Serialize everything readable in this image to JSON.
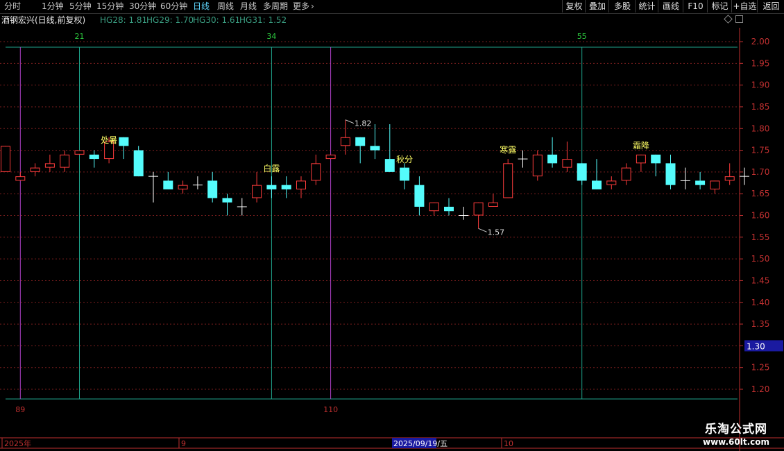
{
  "toolbar": {
    "periods": [
      "分时",
      "1分钟",
      "5分钟",
      "15分钟",
      "30分钟",
      "60分钟",
      "日线",
      "周线",
      "月线",
      "多周期",
      "更多"
    ],
    "more_arrow": "›",
    "active_period": "日线",
    "tools": [
      "复权",
      "叠加",
      "多股",
      "统计",
      "画线",
      "F10",
      "标记",
      "+自选",
      "返回"
    ]
  },
  "stock": {
    "title": "酒钢宏兴(日线,前复权)",
    "indicators": [
      "HG28: 1.81",
      "HG29: 1.70",
      "HG30: 1.61",
      "HG31: 1.52"
    ]
  },
  "colors": {
    "up": "#ff3c3c",
    "down": "#54fcfc",
    "doji": "#ffffff",
    "axis": "#c03030",
    "grid": "#7a1e1e",
    "teal_line": "#1fa58c",
    "purple_line": "#b040c8",
    "fib_label": "#2ecc40",
    "solar_term": "#ffff66",
    "cursor_box": "#1a1aa0"
  },
  "chart_data": {
    "type": "candlestick",
    "y_axis_ticks": [
      "2.00",
      "1.95",
      "1.90",
      "1.85",
      "1.80",
      "1.75",
      "1.70",
      "1.65",
      "1.60",
      "1.55",
      "1.50",
      "1.45",
      "1.40",
      "1.35",
      "1.30",
      "1.25",
      "1.20"
    ],
    "ylim": [
      1.2,
      2.0
    ],
    "cursor_price": "1.30",
    "x_labels": [
      "2025年",
      "9",
      "2025/09/19/五",
      "10"
    ],
    "fib_top_labels": [
      "21",
      "34",
      "55"
    ],
    "fib_bottom_labels": [
      "89",
      "110"
    ],
    "solar_terms": [
      "处暑",
      "白露",
      "秋分",
      "寒露",
      "霜降"
    ],
    "high_annotation": "1.82",
    "low_annotation": "1.57",
    "candles": [
      {
        "o": 1.7,
        "h": 1.76,
        "l": 1.7,
        "c": 1.76
      },
      {
        "o": 1.68,
        "h": 1.7,
        "l": 1.68,
        "c": 1.69
      },
      {
        "o": 1.7,
        "h": 1.72,
        "l": 1.69,
        "c": 1.71
      },
      {
        "o": 1.71,
        "h": 1.74,
        "l": 1.7,
        "c": 1.72
      },
      {
        "o": 1.71,
        "h": 1.75,
        "l": 1.7,
        "c": 1.74
      },
      {
        "o": 1.74,
        "h": 1.75,
        "l": 1.74,
        "c": 1.75
      },
      {
        "o": 1.74,
        "h": 1.75,
        "l": 1.71,
        "c": 1.73
      },
      {
        "o": 1.73,
        "h": 1.78,
        "l": 1.72,
        "c": 1.77
      },
      {
        "o": 1.78,
        "h": 1.78,
        "l": 1.73,
        "c": 1.76
      },
      {
        "o": 1.75,
        "h": 1.76,
        "l": 1.69,
        "c": 1.69
      },
      {
        "o": 1.69,
        "h": 1.7,
        "l": 1.63,
        "c": 1.69
      },
      {
        "o": 1.68,
        "h": 1.7,
        "l": 1.66,
        "c": 1.66
      },
      {
        "o": 1.66,
        "h": 1.68,
        "l": 1.65,
        "c": 1.67
      },
      {
        "o": 1.67,
        "h": 1.69,
        "l": 1.66,
        "c": 1.67
      },
      {
        "o": 1.68,
        "h": 1.7,
        "l": 1.63,
        "c": 1.64
      },
      {
        "o": 1.64,
        "h": 1.65,
        "l": 1.6,
        "c": 1.63
      },
      {
        "o": 1.62,
        "h": 1.64,
        "l": 1.6,
        "c": 1.62
      },
      {
        "o": 1.64,
        "h": 1.7,
        "l": 1.63,
        "c": 1.67
      },
      {
        "o": 1.67,
        "h": 1.69,
        "l": 1.64,
        "c": 1.66
      },
      {
        "o": 1.67,
        "h": 1.69,
        "l": 1.64,
        "c": 1.66
      },
      {
        "o": 1.66,
        "h": 1.69,
        "l": 1.64,
        "c": 1.68
      },
      {
        "o": 1.68,
        "h": 1.74,
        "l": 1.67,
        "c": 1.72
      },
      {
        "o": 1.73,
        "h": 1.74,
        "l": 1.73,
        "c": 1.74
      },
      {
        "o": 1.76,
        "h": 1.82,
        "l": 1.74,
        "c": 1.78
      },
      {
        "o": 1.78,
        "h": 1.78,
        "l": 1.72,
        "c": 1.76
      },
      {
        "o": 1.76,
        "h": 1.81,
        "l": 1.73,
        "c": 1.75
      },
      {
        "o": 1.73,
        "h": 1.81,
        "l": 1.7,
        "c": 1.7
      },
      {
        "o": 1.71,
        "h": 1.72,
        "l": 1.66,
        "c": 1.68
      },
      {
        "o": 1.67,
        "h": 1.69,
        "l": 1.6,
        "c": 1.62
      },
      {
        "o": 1.61,
        "h": 1.63,
        "l": 1.6,
        "c": 1.63
      },
      {
        "o": 1.62,
        "h": 1.64,
        "l": 1.6,
        "c": 1.61
      },
      {
        "o": 1.6,
        "h": 1.62,
        "l": 1.59,
        "c": 1.6
      },
      {
        "o": 1.6,
        "h": 1.63,
        "l": 1.57,
        "c": 1.63
      },
      {
        "o": 1.62,
        "h": 1.65,
        "l": 1.62,
        "c": 1.63
      },
      {
        "o": 1.64,
        "h": 1.73,
        "l": 1.64,
        "c": 1.72
      },
      {
        "o": 1.73,
        "h": 1.75,
        "l": 1.71,
        "c": 1.73
      },
      {
        "o": 1.69,
        "h": 1.75,
        "l": 1.68,
        "c": 1.74
      },
      {
        "o": 1.74,
        "h": 1.78,
        "l": 1.71,
        "c": 1.72
      },
      {
        "o": 1.71,
        "h": 1.77,
        "l": 1.7,
        "c": 1.73
      },
      {
        "o": 1.72,
        "h": 1.72,
        "l": 1.67,
        "c": 1.68
      },
      {
        "o": 1.68,
        "h": 1.73,
        "l": 1.66,
        "c": 1.66
      },
      {
        "o": 1.67,
        "h": 1.69,
        "l": 1.66,
        "c": 1.68
      },
      {
        "o": 1.68,
        "h": 1.72,
        "l": 1.67,
        "c": 1.71
      },
      {
        "o": 1.72,
        "h": 1.74,
        "l": 1.7,
        "c": 1.74
      },
      {
        "o": 1.74,
        "h": 1.74,
        "l": 1.69,
        "c": 1.72
      },
      {
        "o": 1.72,
        "h": 1.74,
        "l": 1.66,
        "c": 1.67
      },
      {
        "o": 1.68,
        "h": 1.71,
        "l": 1.66,
        "c": 1.68
      },
      {
        "o": 1.68,
        "h": 1.7,
        "l": 1.66,
        "c": 1.67
      },
      {
        "o": 1.66,
        "h": 1.68,
        "l": 1.65,
        "c": 1.68
      },
      {
        "o": 1.68,
        "h": 1.72,
        "l": 1.67,
        "c": 1.69
      },
      {
        "o": 1.69,
        "h": 1.71,
        "l": 1.67,
        "c": 1.69
      }
    ]
  },
  "watermark": {
    "name": "乐淘公式网",
    "url": "www.60lt.com"
  }
}
